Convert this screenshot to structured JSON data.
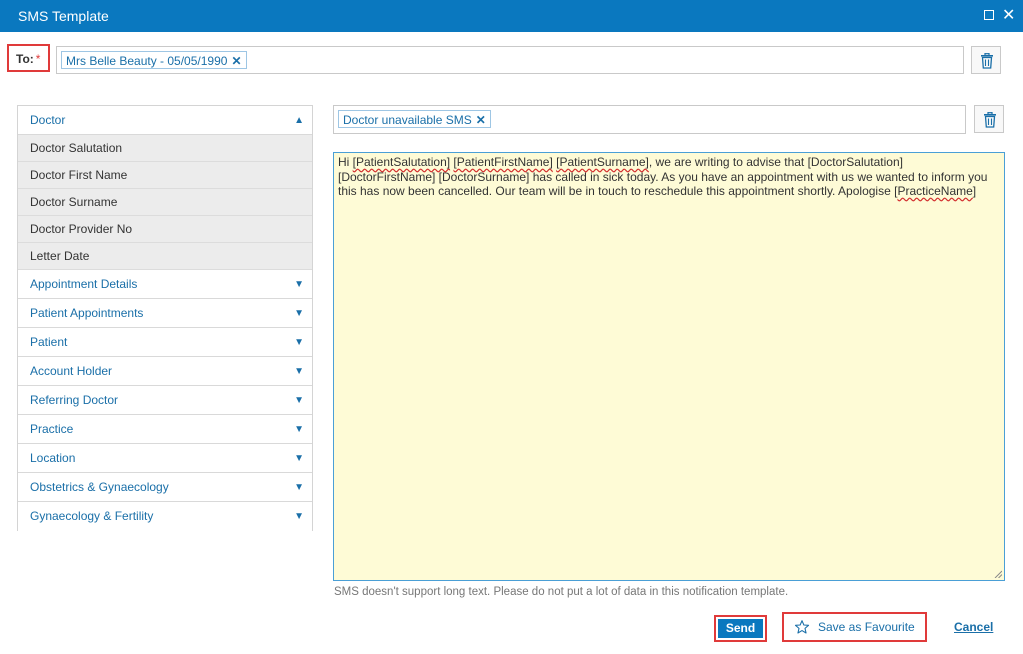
{
  "window": {
    "title": "SMS Template"
  },
  "to": {
    "label": "To:",
    "required_mark": "*",
    "recipients": [
      "Mrs Belle Beauty - 05/05/1990"
    ]
  },
  "accordion": {
    "open_section": "Doctor",
    "doctor_fields": [
      "Doctor Salutation",
      "Doctor First Name",
      "Doctor Surname",
      "Doctor Provider No",
      "Letter Date"
    ],
    "collapsed_sections": [
      "Appointment Details",
      "Patient Appointments",
      "Patient",
      "Account Holder",
      "Referring Doctor",
      "Practice",
      "Location",
      "Obstetrics & Gynaecology",
      "Gynaecology & Fertility"
    ]
  },
  "template": {
    "selected": "Doctor unavailable SMS"
  },
  "message": {
    "t1": "Hi ",
    "t2": "[PatientSalutation]",
    "t3": " ",
    "t4": "[PatientFirstName]",
    "t5": " ",
    "t6": "[PatientSurname]",
    "t7": ", we are writing to advise that [DoctorSalutation] [DoctorFirstName] [DoctorSurname] has called in sick today. As you have an appointment with us we wanted to inform you this has now been cancelled. Our team will be in touch to reschedule this appointment shortly. Apologise [",
    "t8": "PracticeName",
    "t9": "]"
  },
  "hint": "SMS doesn't support long text. Please do not put a lot of data in this notification template.",
  "actions": {
    "send": "Send",
    "favourite": "Save as Favourite",
    "cancel": "Cancel"
  },
  "colors": {
    "header": "#0a78bf",
    "accent": "#1a6fa8",
    "message_bg": "#fefbd6",
    "highlight_border": "#e03a3a"
  }
}
